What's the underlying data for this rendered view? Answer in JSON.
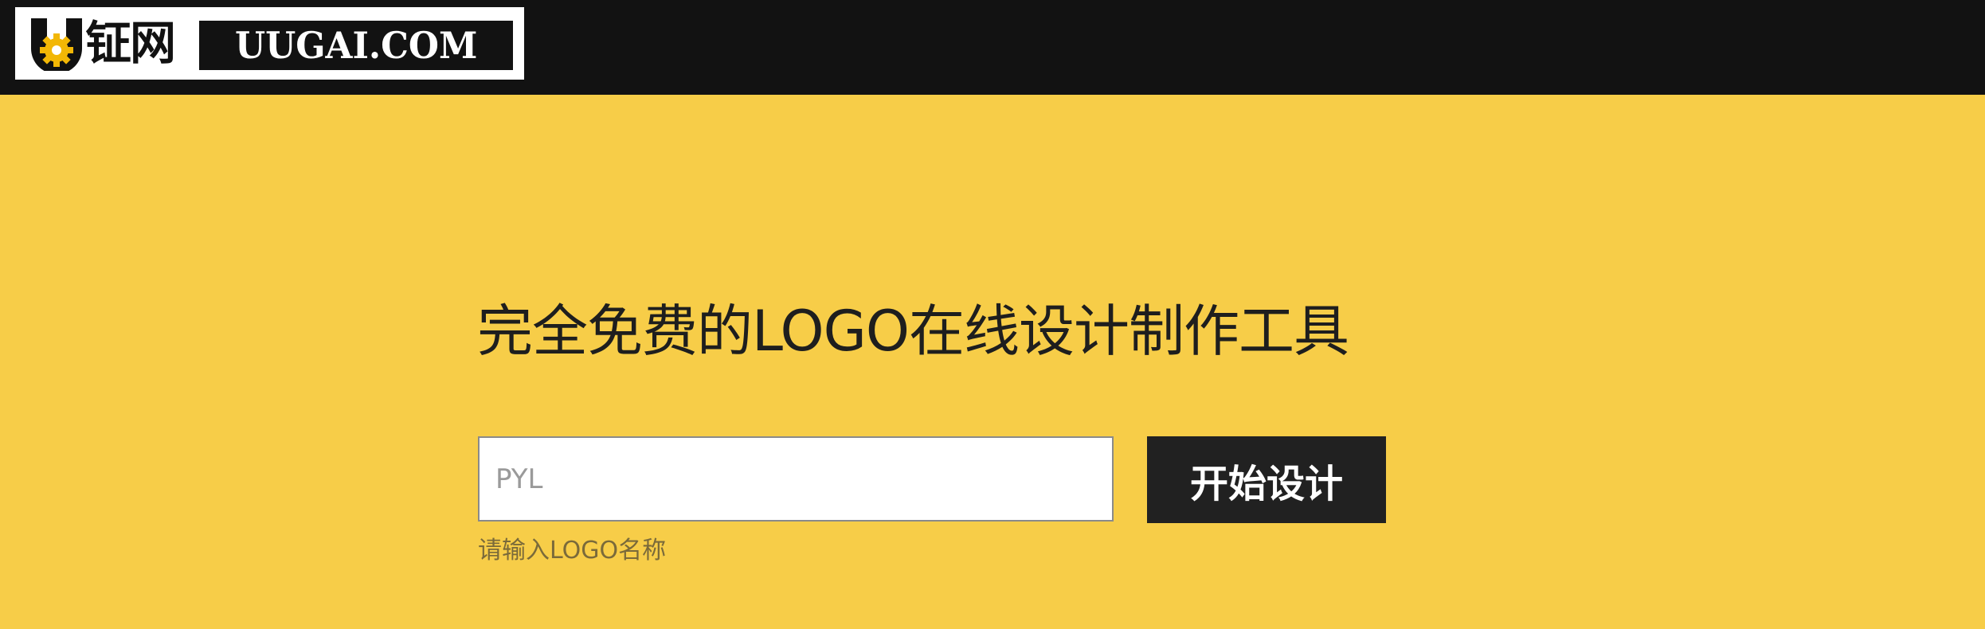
{
  "header": {
    "logo_cn": "钲网",
    "logo_en": "UUGAI.COM"
  },
  "hero": {
    "headline": "完全免费的LOGO在线设计制作工具"
  },
  "form": {
    "input_placeholder": "PYL",
    "button_label": "开始设计",
    "hint": "请输入LOGO名称"
  },
  "colors": {
    "background": "#f7cd48",
    "topbar": "#121212",
    "button": "#212121"
  }
}
